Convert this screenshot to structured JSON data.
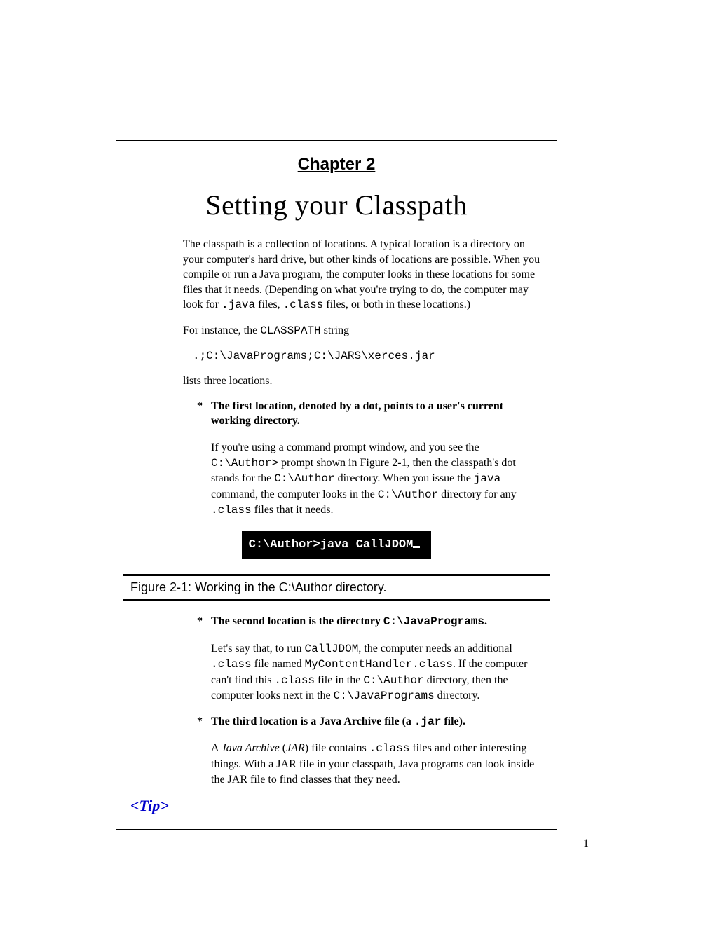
{
  "chapter": "Chapter 2",
  "title": "Setting your Classpath",
  "intro": {
    "p1_a": "The classpath is a collection of locations. A typical location is a directory on your computer's hard drive, but other kinds of locations are possible. When you compile or run a Java program, the computer looks in these locations for some files that it needs. (Depending on what you're trying to do, the computer may look for ",
    "p1_code1": ".java",
    "p1_b": " files, ",
    "p1_code2": ".class",
    "p1_c": " files, or both in these locations.)",
    "p2_a": "For instance, the ",
    "p2_code": "CLASSPATH",
    "p2_b": " string",
    "example": ".;C:\\JavaPrograms;C:\\JARS\\xerces.jar",
    "p3": "lists three locations."
  },
  "bullets": {
    "b1": {
      "head": "The first location, denoted by a dot, points to a user's current working directory.",
      "body_a": "If you're using a command prompt window, and you see the ",
      "body_code1": "C:\\Author>",
      "body_b": " prompt shown in Figure 2-1, then the classpath's dot stands for the ",
      "body_code2": "C:\\Author",
      "body_c": " directory. When you issue the ",
      "body_code3": "java",
      "body_d": " command, the computer looks in the ",
      "body_code4": "C:\\Author",
      "body_e": " directory for any ",
      "body_code5": ".class",
      "body_f": " files that it needs."
    },
    "b2": {
      "head_a": "The second location is the directory ",
      "head_code": "C:\\JavaPrograms",
      "head_b": ".",
      "body_a": "Let's say that, to run ",
      "body_code1": "CallJDOM",
      "body_b": ", the computer needs an additional ",
      "body_code2": ".class",
      "body_c": " file named ",
      "body_code3": "MyContentHandler.class",
      "body_d": ". If the computer can't find this ",
      "body_code4": ".class",
      "body_e": " file in the ",
      "body_code5": "C:\\Author",
      "body_f": " directory, then the computer looks next in the ",
      "body_code6": "C:\\JavaPrograms",
      "body_g": " directory."
    },
    "b3": {
      "head_a": "The third location is a Java Archive file (a ",
      "head_code": ".jar",
      "head_b": " file).",
      "body_a": "A ",
      "body_i1": "Java Archive",
      "body_b": " (",
      "body_i2": "JAR",
      "body_c": ") file contains ",
      "body_code1": ".class",
      "body_d": " files and other interesting things. With a JAR file in your classpath, Java programs can look inside the JAR file to find classes that they need."
    }
  },
  "terminal": "C:\\Author>java CallJDOM",
  "figcaption": "Figure 2-1: Working in the C:\\Author directory.",
  "tip": "<Tip>",
  "pagenum": "1"
}
